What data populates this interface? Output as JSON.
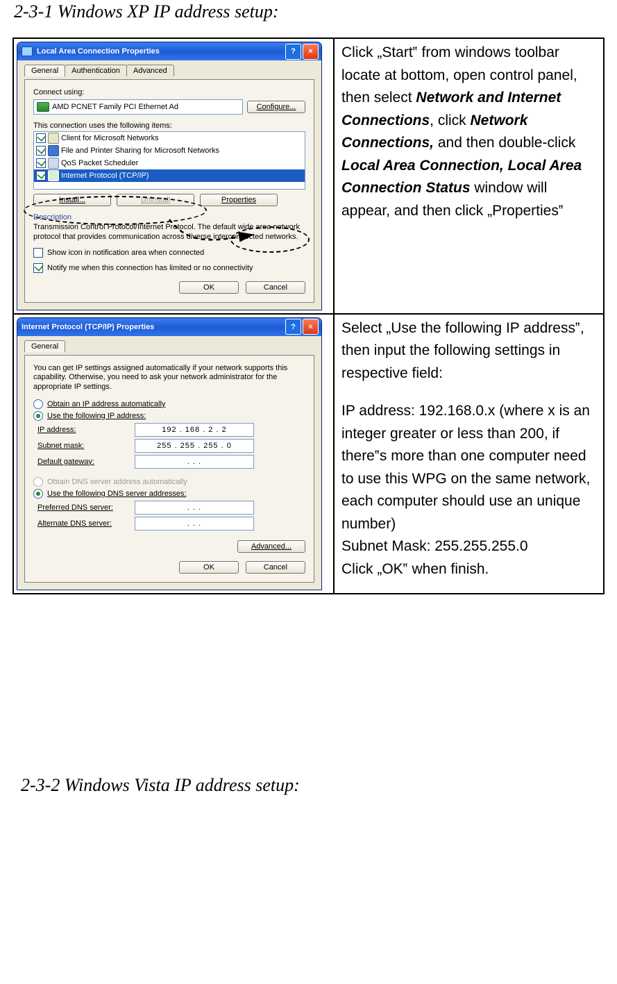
{
  "headings": {
    "h231": "2-3-1 Windows XP IP address setup:",
    "h232": "2-3-2 Windows Vista IP address setup:"
  },
  "instructions": {
    "row1": {
      "p1a": "Click „Start‟ from windows toolbar locate at bottom, open control panel, then select ",
      "b1": "Network and Internet Connections",
      "p1b": ", click ",
      "b2": "Network Connections,",
      "p1c": " and then double-click ",
      "b3": "Local Area Connection, Local Area Connection Status",
      "p1d": " window will appear, and then click „Properties‟"
    },
    "row2": {
      "p1": "Select „Use the following IP address‟, then input the following settings in respective field:",
      "p2": "IP address: 192.168.0.x (where x is an integer greater or less than 200, if there‟s more than one computer need to use this WPG on the same network, each computer should use an unique number)",
      "p3": "Subnet Mask: 255.255.255.0",
      "p4": "Click „OK‟ when finish."
    }
  },
  "lacp": {
    "title": "Local Area Connection Properties",
    "help": "?",
    "close": "×",
    "tabs": {
      "general": "General",
      "auth": "Authentication",
      "adv": "Advanced"
    },
    "connect_using": "Connect using:",
    "adapter": "AMD PCNET Family PCI Ethernet Ad",
    "configure": "Configure...",
    "items_label": "This connection uses the following items:",
    "items": {
      "client": "Client for Microsoft Networks",
      "share": "File and Printer Sharing for Microsoft Networks",
      "qos": "QoS Packet Scheduler",
      "tcpip": "Internet Protocol (TCP/IP)"
    },
    "install": "Install...",
    "uninstall": "Uninstall",
    "properties": "Properties",
    "desc_head": "Description",
    "desc": "Transmission Control Protocol/Internet Protocol. The default wide area network protocol that provides communication across diverse interconnected networks.",
    "show_icon": "Show icon in notification area when connected",
    "notify_me": "Notify me when this connection has limited or no connectivity",
    "ok": "OK",
    "cancel": "Cancel"
  },
  "tcpip": {
    "title": "Internet Protocol (TCP/IP) Properties",
    "help": "?",
    "close": "×",
    "tab": "General",
    "intro": "You can get IP settings assigned automatically if your network supports this capability. Otherwise, you need to ask your network administrator for the appropriate IP settings.",
    "obtain_ip": "Obtain an IP address automatically",
    "use_ip": "Use the following IP address:",
    "ip_label": "IP address:",
    "ip_value": "192 . 168 .   2  .   2",
    "sm_label": "Subnet mask:",
    "sm_value": "255 . 255 . 255 .   0",
    "gw_label": "Default gateway:",
    "gw_value": ".      .      .",
    "obtain_dns": "Obtain DNS server address automatically",
    "use_dns": "Use the following DNS server addresses:",
    "pdns_label": "Preferred DNS server:",
    "pdns_value": ".      .      .",
    "adns_label": "Alternate DNS server:",
    "adns_value": ".      .      .",
    "advanced": "Advanced...",
    "ok": "OK",
    "cancel": "Cancel"
  }
}
